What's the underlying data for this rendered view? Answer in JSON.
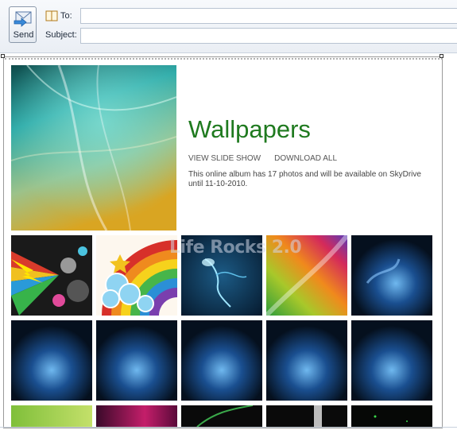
{
  "compose": {
    "send_label": "Send",
    "to_label": "To:",
    "to_value": "",
    "subject_label": "Subject:",
    "subject_value": ""
  },
  "album": {
    "title": "Wallpapers",
    "actions": [
      "VIEW SLIDE SHOW",
      "DOWNLOAD ALL"
    ],
    "description": "This online album has 17 photos and will be available on SkyDrive until 11-10-2010.",
    "watermark": "Life Rocks 2.0"
  },
  "colors": {
    "title_green": "#1f7a1f",
    "frame_border": "#9a9a9a"
  },
  "thumbnails": [
    {
      "name": "graffiti-lightning"
    },
    {
      "name": "rainbow-clouds"
    },
    {
      "name": "blue-bird"
    },
    {
      "name": "colorful-streaks"
    },
    {
      "name": "blue-aurora"
    },
    {
      "name": "blue-aurora"
    },
    {
      "name": "blue-aurora"
    },
    {
      "name": "blue-aurora"
    },
    {
      "name": "blue-aurora"
    },
    {
      "name": "blue-aurora"
    },
    {
      "name": "green-gradient"
    },
    {
      "name": "pink-magenta"
    },
    {
      "name": "dark-green-swirl"
    },
    {
      "name": "dark-light-beam"
    },
    {
      "name": "dark-green-dots"
    }
  ]
}
